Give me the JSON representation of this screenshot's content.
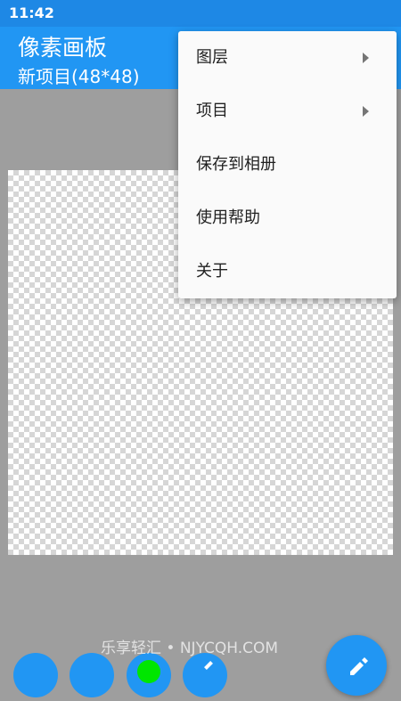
{
  "status_bar": {
    "time": "11:42"
  },
  "app_bar": {
    "title": "像素画板",
    "subtitle": "新项目(48*48)"
  },
  "menu": {
    "items": [
      {
        "label": "图层",
        "submenu": true
      },
      {
        "label": "项目",
        "submenu": true
      },
      {
        "label": "保存到相册",
        "submenu": false
      },
      {
        "label": "使用帮助",
        "submenu": false
      },
      {
        "label": "关于",
        "submenu": false
      }
    ]
  },
  "toolbar": {
    "icons": [
      "tool-icon",
      "tool-icon",
      "color-picker-icon",
      "pen-tool-icon"
    ],
    "fab_icon": "pencil-icon",
    "selected_color": "#00e600"
  },
  "watermark": "乐享轻汇 • NJYCQH.COM",
  "colors": {
    "accent": "#2196f3",
    "status_bar": "#1e88e5",
    "background": "#9e9e9e"
  }
}
